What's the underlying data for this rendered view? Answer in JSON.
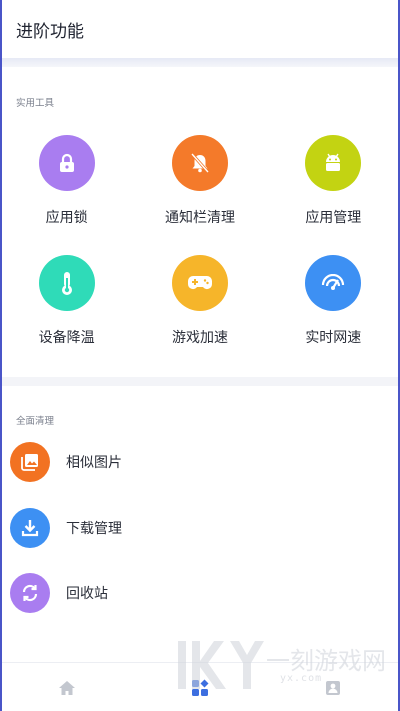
{
  "header": {
    "title": "进阶功能"
  },
  "sections": {
    "tools_label": "实用工具",
    "cleanup_label": "全面清理"
  },
  "tools": [
    {
      "label": "应用锁",
      "icon": "lock-icon",
      "color": "#a97df0"
    },
    {
      "label": "通知栏清理",
      "icon": "bell-off-icon",
      "color": "#f47a2a"
    },
    {
      "label": "应用管理",
      "icon": "android-icon",
      "color": "#c3d312"
    },
    {
      "label": "设备降温",
      "icon": "thermometer-icon",
      "color": "#2fdbb8"
    },
    {
      "label": "游戏加速",
      "icon": "gamepad-icon",
      "color": "#f6b52a"
    },
    {
      "label": "实时网速",
      "icon": "speedometer-icon",
      "color": "#3d90f3"
    }
  ],
  "cleanup": [
    {
      "label": "相似图片",
      "icon": "photos-icon",
      "color": "#f27222"
    },
    {
      "label": "下载管理",
      "icon": "download-icon",
      "color": "#3d90f3"
    },
    {
      "label": "回收站",
      "icon": "recycle-icon",
      "color": "#a97df0"
    }
  ],
  "tabbar": {
    "active": "tools"
  },
  "watermark": {
    "main": "一刻游戏网",
    "sub": "yx.com"
  }
}
